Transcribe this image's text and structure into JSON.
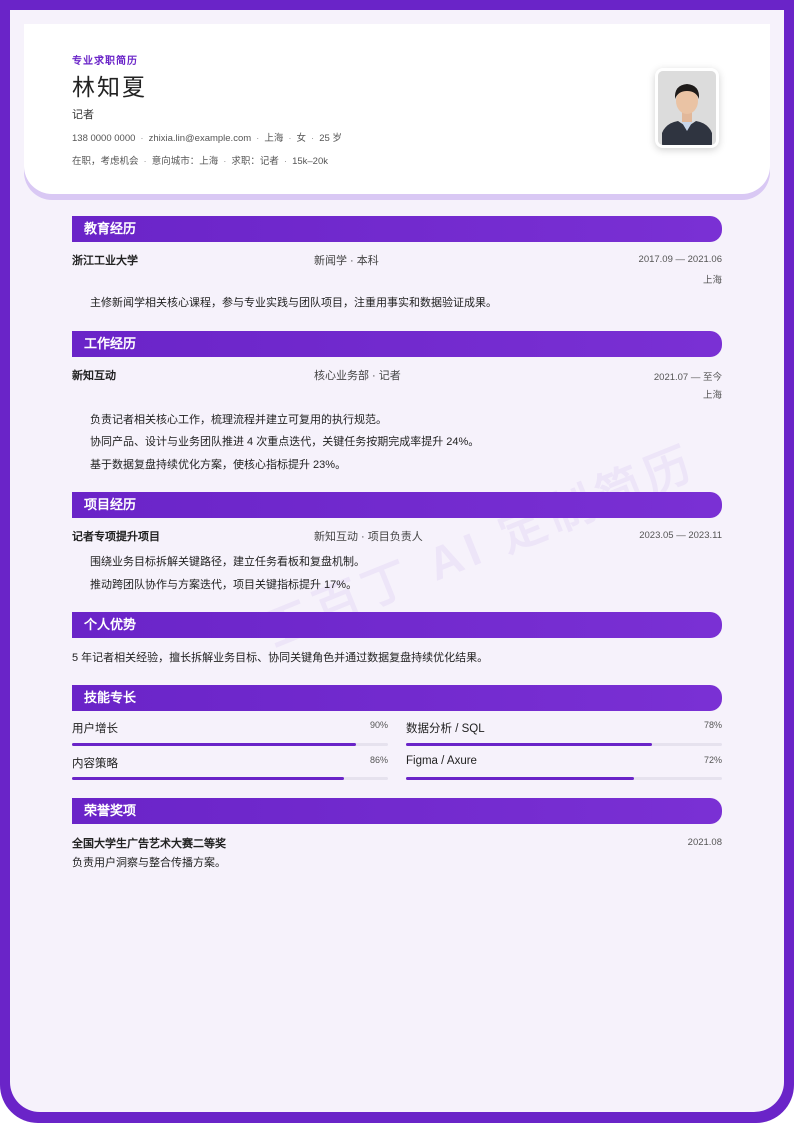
{
  "header": {
    "kicker": "专业求职简历",
    "name": "林知夏",
    "title": "记者",
    "phone": "138 0000 0000",
    "email": "zhixia.lin@example.com",
    "city": "上海",
    "gender": "女",
    "age": "25 岁",
    "status": "在职，考虑机会",
    "intent_city": "意向城市：上海",
    "intent_job": "求职：记者",
    "salary": "15k–20k"
  },
  "watermark": "五百丁 AI 定制简历",
  "education": {
    "heading": "教育经历",
    "school": "浙江工业大学",
    "major": "新闻学 · 本科",
    "period": "2017.09 — 2021.06",
    "location": "上海",
    "desc": "主修新闻学相关核心课程，参与专业实践与团队项目，注重用事实和数据验证成果。"
  },
  "work": {
    "heading": "工作经历",
    "company": "新知互动",
    "role": "核心业务部 · 记者",
    "period": "2021.07 — 至今",
    "location": "上海",
    "bullets": [
      "负责记者相关核心工作，梳理流程并建立可复用的执行规范。",
      "协同产品、设计与业务团队推进 4 次重点迭代，关键任务按期完成率提升 24%。",
      "基于数据复盘持续优化方案，使核心指标提升 23%。"
    ]
  },
  "project": {
    "heading": "项目经历",
    "name": "记者专项提升项目",
    "role": "新知互动 · 项目负责人",
    "period": "2023.05 — 2023.11",
    "bullets": [
      "围绕业务目标拆解关键路径，建立任务看板和复盘机制。",
      "推动跨团队协作与方案迭代，项目关键指标提升 17%。"
    ]
  },
  "strengths": {
    "heading": "个人优势",
    "text": "5 年记者相关经验，擅长拆解业务目标、协同关键角色并通过数据复盘持续优化结果。"
  },
  "skills": {
    "heading": "技能专长",
    "items": [
      {
        "label": "用户增长",
        "pct": "90%",
        "value": 0.9
      },
      {
        "label": "数据分析 / SQL",
        "pct": "78%",
        "value": 0.78
      },
      {
        "label": "内容策略",
        "pct": "86%",
        "value": 0.86
      },
      {
        "label": "Figma / Axure",
        "pct": "72%",
        "value": 0.72
      }
    ]
  },
  "honors": {
    "heading": "荣誉奖项",
    "name": "全国大学生广告艺术大赛二等奖",
    "date": "2021.08",
    "desc": "负责用户洞察与整合传播方案。"
  },
  "colors": {
    "accent": "#6a24c8",
    "page_bg": "#f6f2fb"
  },
  "icons": {
    "photo": "portrait-photo"
  }
}
